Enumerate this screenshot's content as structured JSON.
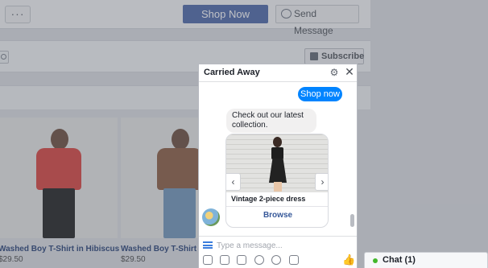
{
  "page": {
    "more_label": "···",
    "shop_now_label": "Shop Now",
    "send_message_label": "Send Message",
    "subscribe_label": "Subscribe",
    "products": [
      {
        "name": "Washed Boy T-Shirt in Hibiscus",
        "price": "$29.50"
      },
      {
        "name": "Washed Boy T-Shirt in Brown",
        "price": "$29.50"
      }
    ]
  },
  "chat": {
    "title": "Carried Away",
    "settings_glyph": "⚙",
    "close_glyph": "✕",
    "messages": {
      "outgoing": "Shop now",
      "incoming": "Check out our latest collection."
    },
    "card": {
      "title": "Vintage 2-piece dress",
      "button": "Browse",
      "prev_glyph": "‹",
      "next_glyph": "›"
    },
    "input": {
      "value": "",
      "placeholder": "Type a message..."
    },
    "like_glyph": "👍"
  },
  "chatbar": {
    "label": "Chat (1)"
  },
  "colors": {
    "messenger_blue": "#0084ff",
    "link_blue": "#365899",
    "online_green": "#42b72a",
    "shop_button": "#4a64a6"
  },
  "icons": [
    "more-icon",
    "messenger-icon",
    "search-icon",
    "rss-icon",
    "gear-icon",
    "close-icon",
    "menu-icon",
    "image-icon",
    "sticker-icon",
    "gif-icon",
    "emoji-icon",
    "attachment-icon",
    "camera-icon",
    "like-icon"
  ]
}
